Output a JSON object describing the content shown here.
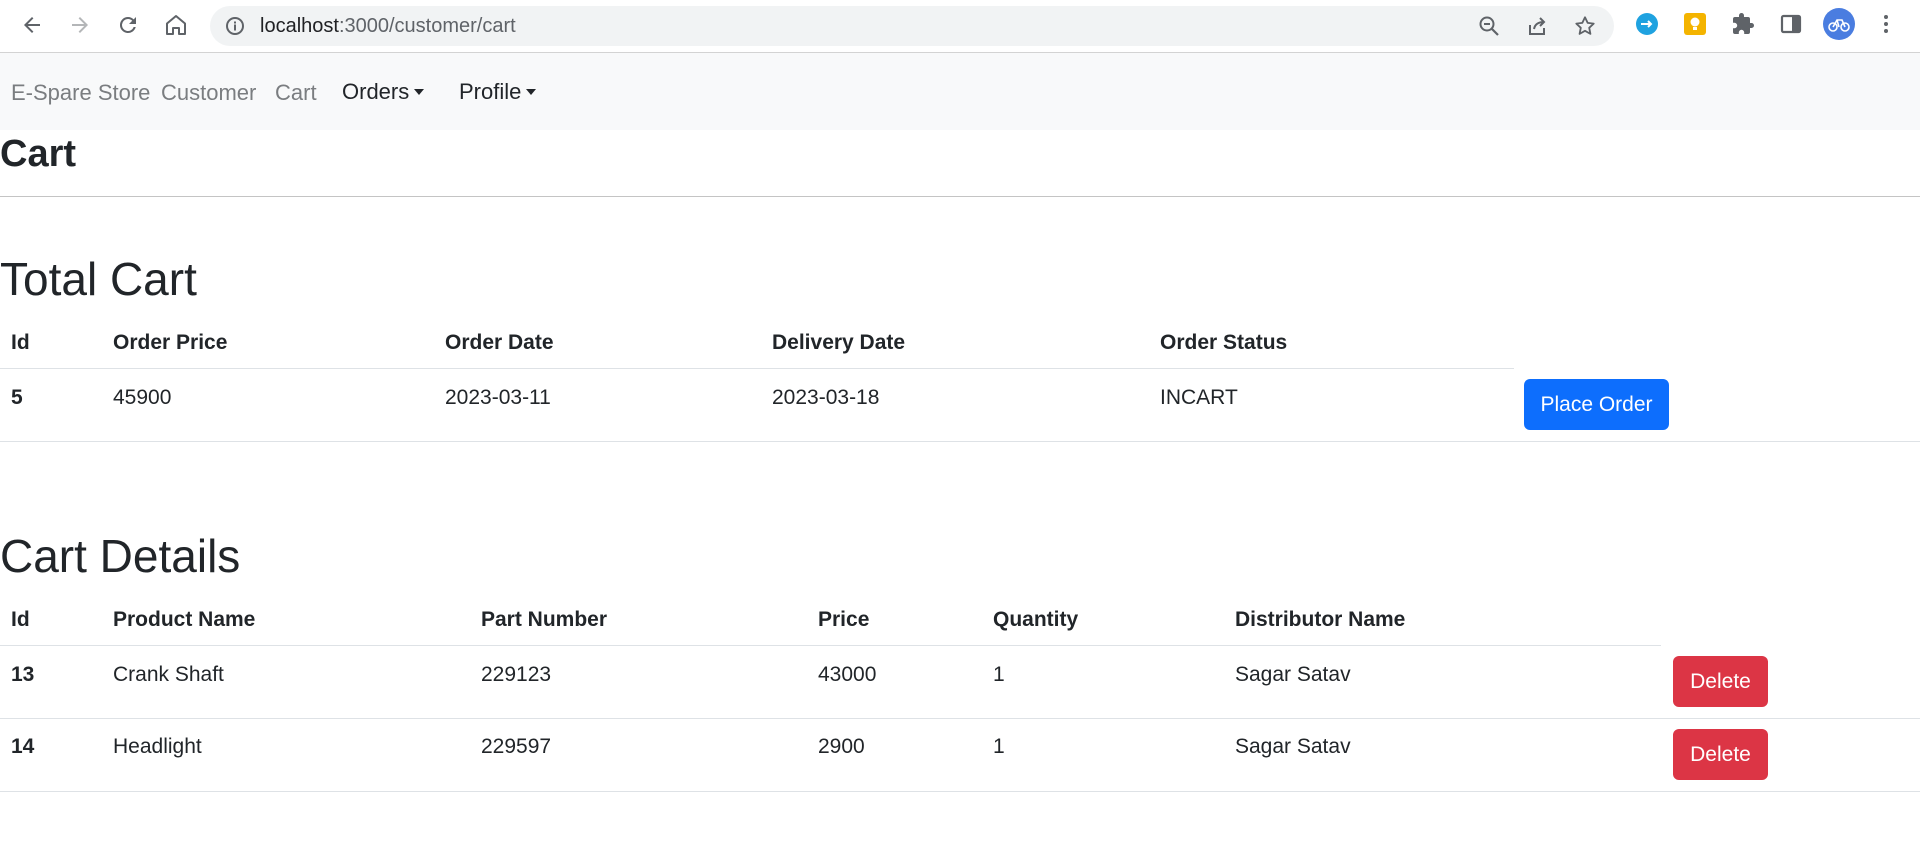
{
  "browser": {
    "url_host": "localhost",
    "url_path": ":3000/customer/cart"
  },
  "navbar": {
    "brand": "E-Spare Store",
    "links": [
      "Customer",
      "Cart"
    ],
    "dropdowns": [
      "Orders",
      "Profile"
    ]
  },
  "page": {
    "title": "Cart"
  },
  "total_cart": {
    "title": "Total Cart",
    "columns": [
      "Id",
      "Order Price",
      "Order Date",
      "Delivery Date",
      "Order Status"
    ],
    "rows": [
      {
        "id": "5",
        "order_price": "45900",
        "order_date": "2023-03-11",
        "delivery_date": "2023-03-18",
        "status": "INCART",
        "action": "Place Order"
      }
    ]
  },
  "cart_details": {
    "title": "Cart Details",
    "columns": [
      "Id",
      "Product Name",
      "Part Number",
      "Price",
      "Quantity",
      "Distributor Name"
    ],
    "rows": [
      {
        "id": "13",
        "product": "Crank Shaft",
        "part_number": "229123",
        "price": "43000",
        "quantity": "1",
        "distributor": "Sagar Satav",
        "action": "Delete"
      },
      {
        "id": "14",
        "product": "Headlight",
        "part_number": "229597",
        "price": "2900",
        "quantity": "1",
        "distributor": "Sagar Satav",
        "action": "Delete"
      }
    ]
  },
  "colors": {
    "primary": "#0d6efd",
    "danger": "#dc3545",
    "navbar_bg": "#f8f9fa"
  },
  "icons": [
    "back-icon",
    "forward-icon",
    "reload-icon",
    "home-icon",
    "info-icon",
    "zoom-icon",
    "share-icon",
    "bookmark-star-icon",
    "extension-blue-icon",
    "extension-yellow-icon",
    "puzzle-icon",
    "side-panel-icon",
    "profile-avatar-icon",
    "menu-kebab-icon"
  ]
}
